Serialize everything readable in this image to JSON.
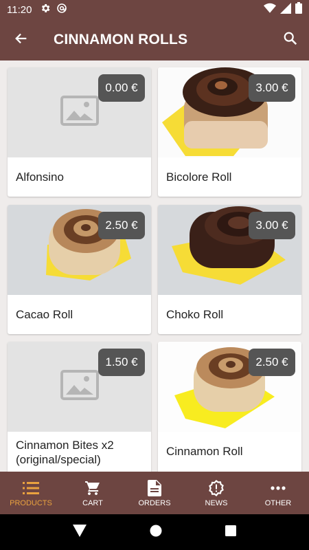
{
  "status_bar": {
    "time": "11:20",
    "icons": [
      "gear-icon",
      "at-sign-icon",
      "wifi-icon",
      "signal-icon",
      "battery-icon"
    ]
  },
  "app_bar": {
    "title": "CINNAMON ROLLS",
    "icons": [
      "back-arrow-icon",
      "search-icon"
    ]
  },
  "products": [
    {
      "name": "Alfonsino",
      "price": "0.00 €",
      "image": "placeholder"
    },
    {
      "name": "Bicolore Roll",
      "price": "3.00 €",
      "image": "bicolore-roll"
    },
    {
      "name": "Cacao Roll",
      "price": "2.50 €",
      "image": "cacao-roll"
    },
    {
      "name": "Choko Roll",
      "price": "3.00 €",
      "image": "choko-roll"
    },
    {
      "name": "Cinnamon Bites x2 (original/special)",
      "price": "1.50 €",
      "image": "placeholder"
    },
    {
      "name": "Cinnamon Roll",
      "price": "2.50 €",
      "image": "cinnamon-roll"
    }
  ],
  "bottom_nav": [
    {
      "label": "PRODUCTS",
      "icon": "list-icon",
      "active": true
    },
    {
      "label": "CART",
      "icon": "cart-icon",
      "active": false
    },
    {
      "label": "ORDERS",
      "icon": "document-icon",
      "active": false
    },
    {
      "label": "NEWS",
      "icon": "alert-badge-icon",
      "active": false
    },
    {
      "label": "OTHER",
      "icon": "more-icon",
      "active": false
    }
  ],
  "system_nav": [
    "back-triangle-icon",
    "home-circle-icon",
    "recents-square-icon"
  ],
  "colors": {
    "primary": "#6d4541",
    "accent": "#e9a23f",
    "price_badge": "#555555",
    "placeholder_bg": "#e3e3e3"
  }
}
